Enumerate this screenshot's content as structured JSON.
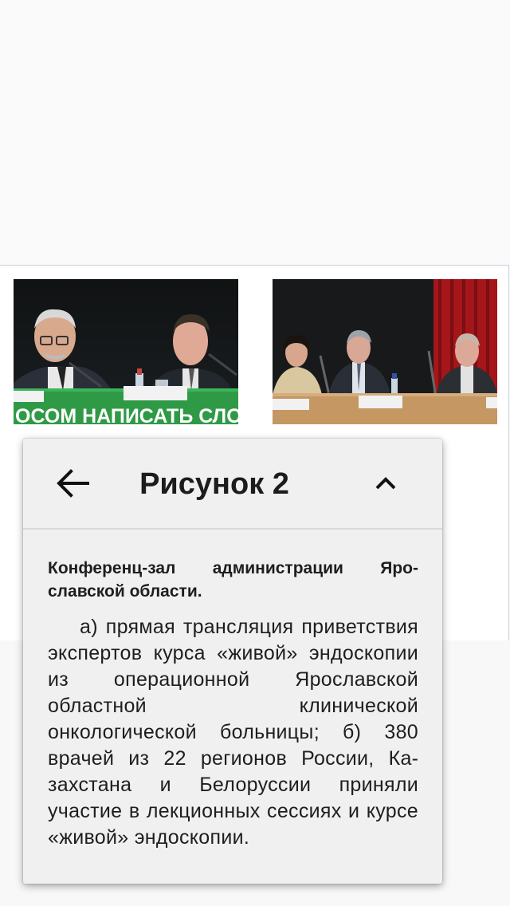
{
  "popup": {
    "title": "Рисунок 2",
    "back_icon": "arrow-left-icon",
    "collapse_icon": "chevron-up-icon",
    "caption_heading": "Конференц-зал администрации Яро­славской области.",
    "caption_text": "а) прямая трансляция привет­ствия экспертов курса «живой» эн­доскопии из операционной Яро­славской областной клинической онкологической больницы; б) 380 врачей из 22 регионов России, Ка­захстана и Белоруссии приняли участие в лекционных сессиях и курсе «живой» эндоскопии."
  },
  "figure": {
    "photo_a": {
      "banner_text": "ОСОМ НАПИСАТЬ СЛОВО"
    }
  },
  "colors": {
    "accent_green": "#2f9a46",
    "popup_bg": "#f0f0f0",
    "frame_border": "#c9d1e0"
  }
}
